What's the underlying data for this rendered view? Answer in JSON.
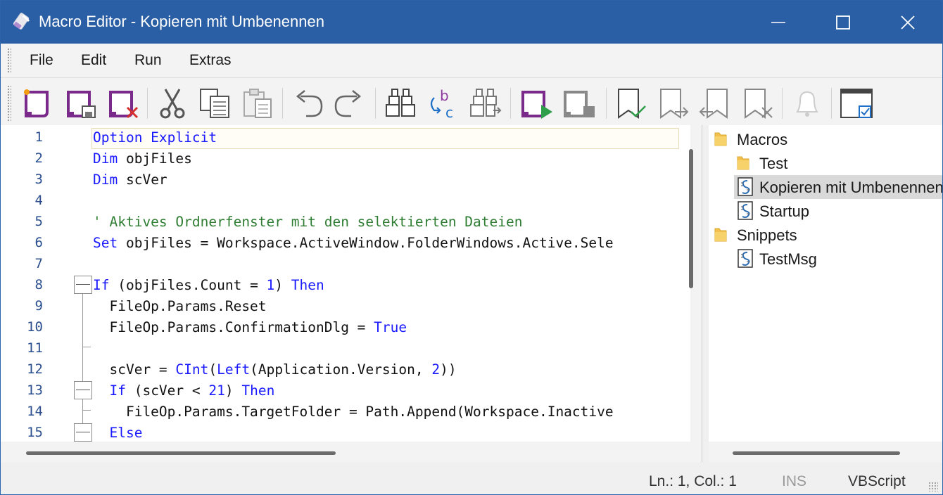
{
  "window": {
    "title": "Macro Editor - Kopieren mit Umbenennen",
    "app_icon": "macro-editor-icon"
  },
  "menu": [
    "File",
    "Edit",
    "Run",
    "Extras"
  ],
  "toolbar": [
    {
      "name": "new-macro-button",
      "icon": "new-script-icon"
    },
    {
      "name": "save-macro-button",
      "icon": "save-script-icon"
    },
    {
      "name": "delete-macro-button",
      "icon": "delete-script-icon"
    },
    {
      "name": "cut-button",
      "icon": "scissors-icon"
    },
    {
      "name": "copy-button",
      "icon": "copy-icon"
    },
    {
      "name": "paste-button",
      "icon": "paste-icon"
    },
    {
      "name": "undo-button",
      "icon": "undo-arrow-icon"
    },
    {
      "name": "redo-button",
      "icon": "redo-arrow-icon"
    },
    {
      "name": "find-button",
      "icon": "binoculars-icon"
    },
    {
      "name": "replace-button",
      "icon": "replace-bc-icon"
    },
    {
      "name": "find-next-button",
      "icon": "binoculars-next-icon"
    },
    {
      "name": "run-button",
      "icon": "run-script-icon"
    },
    {
      "name": "stop-button",
      "icon": "stop-script-icon"
    },
    {
      "name": "toggle-bookmark-button",
      "icon": "bookmark-check-icon"
    },
    {
      "name": "next-bookmark-button",
      "icon": "bookmark-next-icon"
    },
    {
      "name": "previous-bookmark-button",
      "icon": "bookmark-previous-icon"
    },
    {
      "name": "clear-bookmarks-button",
      "icon": "bookmark-clear-icon"
    },
    {
      "name": "notification-button",
      "icon": "bell-icon"
    },
    {
      "name": "toggle-panel-button",
      "icon": "window-check-icon"
    }
  ],
  "code_lines": [
    {
      "num": "1",
      "code": [
        {
          "t": "Option Explicit",
          "c": "kw"
        }
      ]
    },
    {
      "num": "2",
      "code": [
        {
          "t": "Dim",
          "c": "kw"
        },
        {
          "t": " objFiles",
          "c": ""
        }
      ]
    },
    {
      "num": "3",
      "code": [
        {
          "t": "Dim",
          "c": "kw"
        },
        {
          "t": " scVer",
          "c": ""
        }
      ]
    },
    {
      "num": "4",
      "code": []
    },
    {
      "num": "5",
      "code": [
        {
          "t": "' Aktives Ordnerfenster mit den selektierten Dateien",
          "c": "cm"
        }
      ]
    },
    {
      "num": "6",
      "code": [
        {
          "t": "Set",
          "c": "kw"
        },
        {
          "t": " objFiles = Workspace.ActiveWindow.FolderWindows.Active.Sele",
          "c": ""
        }
      ]
    },
    {
      "num": "7",
      "code": []
    },
    {
      "num": "8",
      "code": [
        {
          "t": "If",
          "c": "kw"
        },
        {
          "t": " (objFiles.Count = ",
          "c": ""
        },
        {
          "t": "1",
          "c": "num"
        },
        {
          "t": ") ",
          "c": ""
        },
        {
          "t": "Then",
          "c": "kw"
        }
      ]
    },
    {
      "num": "9",
      "code": [
        {
          "t": "  FileOp.Params.Reset",
          "c": ""
        }
      ]
    },
    {
      "num": "10",
      "code": [
        {
          "t": "  FileOp.Params.ConfirmationDlg = ",
          "c": ""
        },
        {
          "t": "True",
          "c": "kw"
        }
      ]
    },
    {
      "num": "11",
      "code": []
    },
    {
      "num": "12",
      "code": [
        {
          "t": "  scVer = ",
          "c": ""
        },
        {
          "t": "CInt",
          "c": "fn"
        },
        {
          "t": "(",
          "c": ""
        },
        {
          "t": "Left",
          "c": "fn"
        },
        {
          "t": "(Application.Version, ",
          "c": ""
        },
        {
          "t": "2",
          "c": "num"
        },
        {
          "t": "))",
          "c": ""
        }
      ]
    },
    {
      "num": "13",
      "code": [
        {
          "t": "  ",
          "c": ""
        },
        {
          "t": "If",
          "c": "kw"
        },
        {
          "t": " (scVer < ",
          "c": ""
        },
        {
          "t": "21",
          "c": "num"
        },
        {
          "t": ") ",
          "c": ""
        },
        {
          "t": "Then",
          "c": "kw"
        }
      ]
    },
    {
      "num": "14",
      "code": [
        {
          "t": "    FileOp.Params.TargetFolder = Path.Append(Workspace.Inactive",
          "c": ""
        }
      ]
    },
    {
      "num": "15",
      "code": [
        {
          "t": "  ",
          "c": ""
        },
        {
          "t": "Else",
          "c": "kw"
        }
      ]
    }
  ],
  "tree": [
    {
      "label": "Macros",
      "type": "folder",
      "level": 0
    },
    {
      "label": "Test",
      "type": "folder",
      "level": 1
    },
    {
      "label": "Kopieren mit Umbenennen",
      "type": "script",
      "level": 1,
      "selected": true
    },
    {
      "label": "Startup",
      "type": "script",
      "level": 1
    },
    {
      "label": "Snippets",
      "type": "folder",
      "level": 0
    },
    {
      "label": "TestMsg",
      "type": "script",
      "level": 1
    }
  ],
  "status": {
    "position": "Ln.: 1, Col.: 1",
    "mode": "INS",
    "language": "VBScript"
  }
}
